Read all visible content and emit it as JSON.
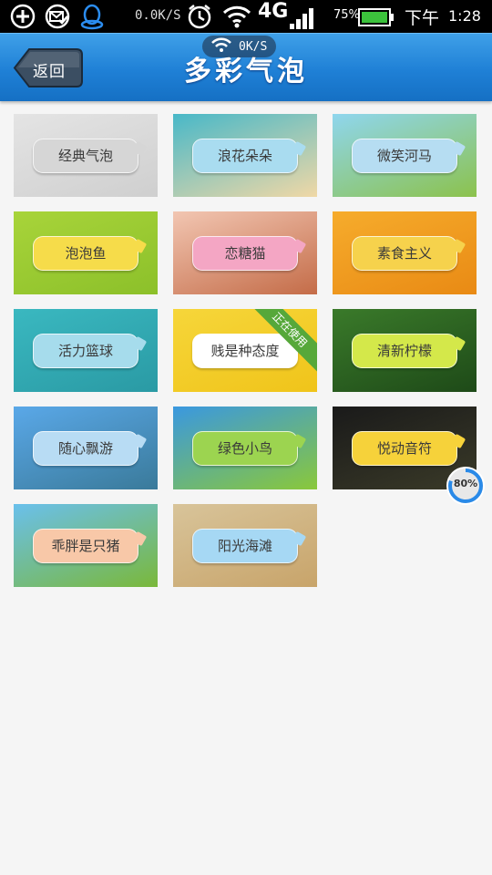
{
  "status_bar": {
    "speed": "0.0K/S",
    "network_type": "4G",
    "battery_percent": "75%",
    "period": "下午",
    "time": "1:28",
    "wifi_speed": "0K/S",
    "icons": [
      "add-circle-icon",
      "mail-check-icon",
      "qq-penguin-icon",
      "alarm-icon",
      "wifi-icon",
      "signal-icon",
      "battery-icon"
    ]
  },
  "header": {
    "back_label": "返回",
    "title": "多彩气泡"
  },
  "bubbles": [
    {
      "label": "经典气泡",
      "bg": "#e4e4e4",
      "bg2": "#cfcfcf",
      "bubble": "#d6d6d6"
    },
    {
      "label": "浪花朵朵",
      "bg": "#48b8c8",
      "bg2": "#f0d8a6",
      "bubble": "#a9dcf0"
    },
    {
      "label": "微笑河马",
      "bg": "#8fd6ee",
      "bg2": "#8cc24c",
      "bubble": "#b6ddf2"
    },
    {
      "label": "泡泡鱼",
      "bg": "#a8d43a",
      "bg2": "#8cc02a",
      "bubble": "#f6dc4a"
    },
    {
      "label": "恋糖猫",
      "bg": "#f2c6b2",
      "bg2": "#c46c48",
      "bubble": "#f4a6c4"
    },
    {
      "label": "素食主义",
      "bg": "#f6ac2c",
      "bg2": "#e98a14",
      "bubble": "#f6d24c"
    },
    {
      "label": "活力篮球",
      "bg": "#3ab8c0",
      "bg2": "#2a9aa4",
      "bubble": "#a6dcec"
    },
    {
      "label": "贱是种态度",
      "bg": "#f6d63a",
      "bg2": "#f0c41a",
      "bubble": "#ffffff",
      "badge": "正在使用"
    },
    {
      "label": "清新柠檬",
      "bg": "#3a7a2a",
      "bg2": "#1e4a18",
      "bubble": "#d4e84a"
    },
    {
      "label": "随心飘游",
      "bg": "#5aa8e8",
      "bg2": "#3a7a9a",
      "bubble": "#b8dcf4"
    },
    {
      "label": "绿色小鸟",
      "bg": "#3a98e0",
      "bg2": "#8ac83a",
      "bubble": "#9cd450"
    },
    {
      "label": "悦动音符",
      "bg": "#1a1a1a",
      "bg2": "#3a3a28",
      "bubble": "#f6d23a"
    },
    {
      "label": "乖胖是只猪",
      "bg": "#6ac0ec",
      "bg2": "#7ab83a",
      "bubble": "#f8c8a8"
    },
    {
      "label": "阳光海滩",
      "bg": "#d8c49a",
      "bg2": "#c8a46a",
      "bubble": "#a6d8f4"
    }
  ],
  "progress": {
    "label": "80%",
    "value": 0.8
  }
}
